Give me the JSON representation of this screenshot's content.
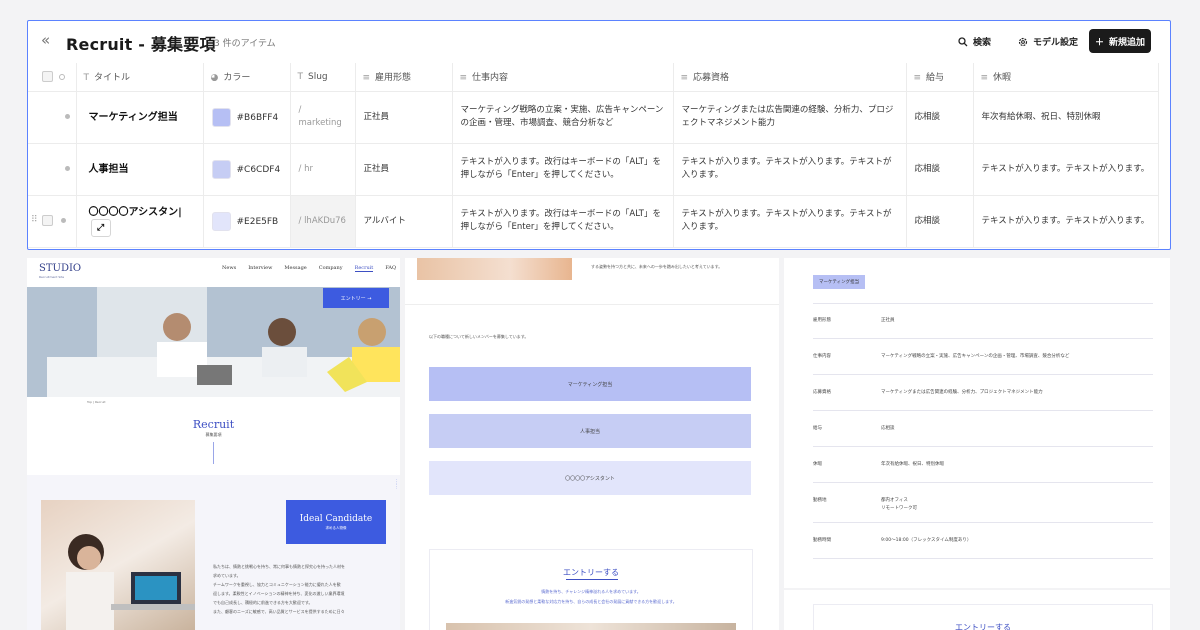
{
  "cms": {
    "title": "Recruit - 募集要項",
    "count": "3 件のアイテム",
    "search_label": "検索",
    "model_settings_label": "モデル設定",
    "add_label": "新規追加",
    "columns": [
      "タイトル",
      "カラー",
      "Slug",
      "雇用形態",
      "仕事内容",
      "応募資格",
      "給与",
      "休暇"
    ],
    "rows": [
      {
        "title": "マーケティング担当",
        "color_hex": "#B6BFF4",
        "color_label": "#B6BFF4",
        "slug": "/ marketing",
        "employment": "正社員",
        "work": "マーケティング戦略の立案・実施、広告キャンペーンの企画・管理、市場調査、競合分析など",
        "qualification": "マーケティングまたは広告関連の経験、分析力、プロジェクトマネジメント能力",
        "salary": "応相談",
        "holiday": "年次有給休暇、祝日、特別休暇"
      },
      {
        "title": "人事担当",
        "color_hex": "#C6CDF4",
        "color_label": "#C6CDF4",
        "slug": "/ hr",
        "employment": "正社員",
        "work": "テキストが入ります。改行はキーボードの「ALT」を押しながら「Enter」を押してください。",
        "qualification": "テキストが入ります。テキストが入ります。テキストが入ります。",
        "salary": "応相談",
        "holiday": "テキストが入ります。テキストが入ります。"
      },
      {
        "title": "〇〇〇〇アシスタン|",
        "color_hex": "#E2E5FB",
        "color_label": "#E2E5FB",
        "slug": "/ lhAKDu76",
        "employment": "アルバイト",
        "work": "テキストが入ります。改行はキーボードの「ALT」を押しながら「Enter」を押してください。",
        "qualification": "テキストが入ります。テキストが入ります。テキストが入ります。",
        "salary": "応相談",
        "holiday": "テキストが入ります。テキストが入ります。"
      }
    ]
  },
  "site": {
    "logo": "STUDIO",
    "logo_sub": "Recruitment Site",
    "nav": [
      "News",
      "Interview",
      "Message",
      "Company",
      "Recruit",
      "FAQ"
    ],
    "entry_button": "エントリー →",
    "breadcrumb": "Top  |  Recruit",
    "recruit_heading": "Recruit",
    "recruit_sub": "募集要項",
    "ideal_heading": "Ideal Candidate",
    "ideal_sub": "求める人物像",
    "body_lines": [
      "私たちは、情熱と挑戦心を持ち、常に何事も情熱と探究心を持った人材を",
      "求めています。",
      "チームワークを重視し、協力とコミュニケーション能力に優れた人を歓",
      "迎します。柔軟性とイノベーションの精神を持ち、変化の激しい業界環境",
      "でも自己成長し、積極的に前進できる方を大歓迎です。",
      "また、顧客のニーズに敏感で、高い品質とサービスを提供するために日々"
    ],
    "mid_top_text": "する姿勢を持つ方と共に、未来への一歩を踏み出したいと考えています。",
    "mid_intro": "以下の職種について新しいメンバーを募集しています。",
    "job_links": [
      "マーケティング担当",
      "人事担当",
      "〇〇〇〇アシスタント"
    ],
    "entry_heading": "エントリーする",
    "entry_text_1": "情熱を持ち、チャレンジ精神溢れる人を求めています。",
    "entry_text_2": "新進気鋭の発想と柔軟な対応力を持ち、自らの成長と会社の発展に貢献できる方を歓迎します。",
    "detail_badge": "マーケティング担当",
    "detail_rows": [
      {
        "k": "雇用形態",
        "v": "正社員"
      },
      {
        "k": "仕事内容",
        "v": "マーケティング戦略の立案・実施、広告キャンペーンの企画・管理、市場調査、競合分析など"
      },
      {
        "k": "応募資格",
        "v": "マーケティングまたは広告関連の経験、分析力、プロジェクトマネジメント能力"
      },
      {
        "k": "給与",
        "v": "応相談"
      },
      {
        "k": "休暇",
        "v": "年次有給休暇、祝日、特別休暇"
      },
      {
        "k": "勤務地",
        "v": "都内オフィス"
      },
      {
        "k": "勤務時間",
        "v": "9:00〜18:00（フレックスタイム制度あり）"
      }
    ],
    "detail_location_2": "リモートワーク可",
    "right_entry_heading": "エントリーする"
  }
}
